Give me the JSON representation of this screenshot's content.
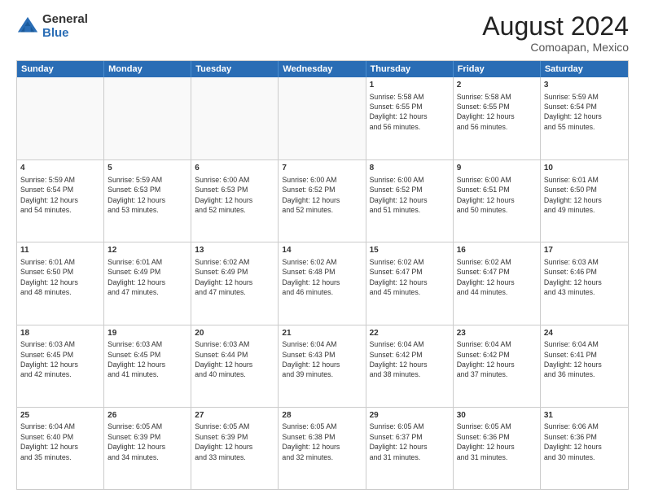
{
  "logo": {
    "general": "General",
    "blue": "Blue"
  },
  "title": {
    "month_year": "August 2024",
    "location": "Comoapan, Mexico"
  },
  "days_of_week": [
    "Sunday",
    "Monday",
    "Tuesday",
    "Wednesday",
    "Thursday",
    "Friday",
    "Saturday"
  ],
  "weeks": [
    [
      {
        "day": "",
        "text": "",
        "empty": true
      },
      {
        "day": "",
        "text": "",
        "empty": true
      },
      {
        "day": "",
        "text": "",
        "empty": true
      },
      {
        "day": "",
        "text": "",
        "empty": true
      },
      {
        "day": "1",
        "text": "Sunrise: 5:58 AM\nSunset: 6:55 PM\nDaylight: 12 hours\nand 56 minutes."
      },
      {
        "day": "2",
        "text": "Sunrise: 5:58 AM\nSunset: 6:55 PM\nDaylight: 12 hours\nand 56 minutes."
      },
      {
        "day": "3",
        "text": "Sunrise: 5:59 AM\nSunset: 6:54 PM\nDaylight: 12 hours\nand 55 minutes."
      }
    ],
    [
      {
        "day": "4",
        "text": "Sunrise: 5:59 AM\nSunset: 6:54 PM\nDaylight: 12 hours\nand 54 minutes."
      },
      {
        "day": "5",
        "text": "Sunrise: 5:59 AM\nSunset: 6:53 PM\nDaylight: 12 hours\nand 53 minutes."
      },
      {
        "day": "6",
        "text": "Sunrise: 6:00 AM\nSunset: 6:53 PM\nDaylight: 12 hours\nand 52 minutes."
      },
      {
        "day": "7",
        "text": "Sunrise: 6:00 AM\nSunset: 6:52 PM\nDaylight: 12 hours\nand 52 minutes."
      },
      {
        "day": "8",
        "text": "Sunrise: 6:00 AM\nSunset: 6:52 PM\nDaylight: 12 hours\nand 51 minutes."
      },
      {
        "day": "9",
        "text": "Sunrise: 6:00 AM\nSunset: 6:51 PM\nDaylight: 12 hours\nand 50 minutes."
      },
      {
        "day": "10",
        "text": "Sunrise: 6:01 AM\nSunset: 6:50 PM\nDaylight: 12 hours\nand 49 minutes."
      }
    ],
    [
      {
        "day": "11",
        "text": "Sunrise: 6:01 AM\nSunset: 6:50 PM\nDaylight: 12 hours\nand 48 minutes."
      },
      {
        "day": "12",
        "text": "Sunrise: 6:01 AM\nSunset: 6:49 PM\nDaylight: 12 hours\nand 47 minutes."
      },
      {
        "day": "13",
        "text": "Sunrise: 6:02 AM\nSunset: 6:49 PM\nDaylight: 12 hours\nand 47 minutes."
      },
      {
        "day": "14",
        "text": "Sunrise: 6:02 AM\nSunset: 6:48 PM\nDaylight: 12 hours\nand 46 minutes."
      },
      {
        "day": "15",
        "text": "Sunrise: 6:02 AM\nSunset: 6:47 PM\nDaylight: 12 hours\nand 45 minutes."
      },
      {
        "day": "16",
        "text": "Sunrise: 6:02 AM\nSunset: 6:47 PM\nDaylight: 12 hours\nand 44 minutes."
      },
      {
        "day": "17",
        "text": "Sunrise: 6:03 AM\nSunset: 6:46 PM\nDaylight: 12 hours\nand 43 minutes."
      }
    ],
    [
      {
        "day": "18",
        "text": "Sunrise: 6:03 AM\nSunset: 6:45 PM\nDaylight: 12 hours\nand 42 minutes."
      },
      {
        "day": "19",
        "text": "Sunrise: 6:03 AM\nSunset: 6:45 PM\nDaylight: 12 hours\nand 41 minutes."
      },
      {
        "day": "20",
        "text": "Sunrise: 6:03 AM\nSunset: 6:44 PM\nDaylight: 12 hours\nand 40 minutes."
      },
      {
        "day": "21",
        "text": "Sunrise: 6:04 AM\nSunset: 6:43 PM\nDaylight: 12 hours\nand 39 minutes."
      },
      {
        "day": "22",
        "text": "Sunrise: 6:04 AM\nSunset: 6:42 PM\nDaylight: 12 hours\nand 38 minutes."
      },
      {
        "day": "23",
        "text": "Sunrise: 6:04 AM\nSunset: 6:42 PM\nDaylight: 12 hours\nand 37 minutes."
      },
      {
        "day": "24",
        "text": "Sunrise: 6:04 AM\nSunset: 6:41 PM\nDaylight: 12 hours\nand 36 minutes."
      }
    ],
    [
      {
        "day": "25",
        "text": "Sunrise: 6:04 AM\nSunset: 6:40 PM\nDaylight: 12 hours\nand 35 minutes."
      },
      {
        "day": "26",
        "text": "Sunrise: 6:05 AM\nSunset: 6:39 PM\nDaylight: 12 hours\nand 34 minutes."
      },
      {
        "day": "27",
        "text": "Sunrise: 6:05 AM\nSunset: 6:39 PM\nDaylight: 12 hours\nand 33 minutes."
      },
      {
        "day": "28",
        "text": "Sunrise: 6:05 AM\nSunset: 6:38 PM\nDaylight: 12 hours\nand 32 minutes."
      },
      {
        "day": "29",
        "text": "Sunrise: 6:05 AM\nSunset: 6:37 PM\nDaylight: 12 hours\nand 31 minutes."
      },
      {
        "day": "30",
        "text": "Sunrise: 6:05 AM\nSunset: 6:36 PM\nDaylight: 12 hours\nand 31 minutes."
      },
      {
        "day": "31",
        "text": "Sunrise: 6:06 AM\nSunset: 6:36 PM\nDaylight: 12 hours\nand 30 minutes."
      }
    ]
  ]
}
